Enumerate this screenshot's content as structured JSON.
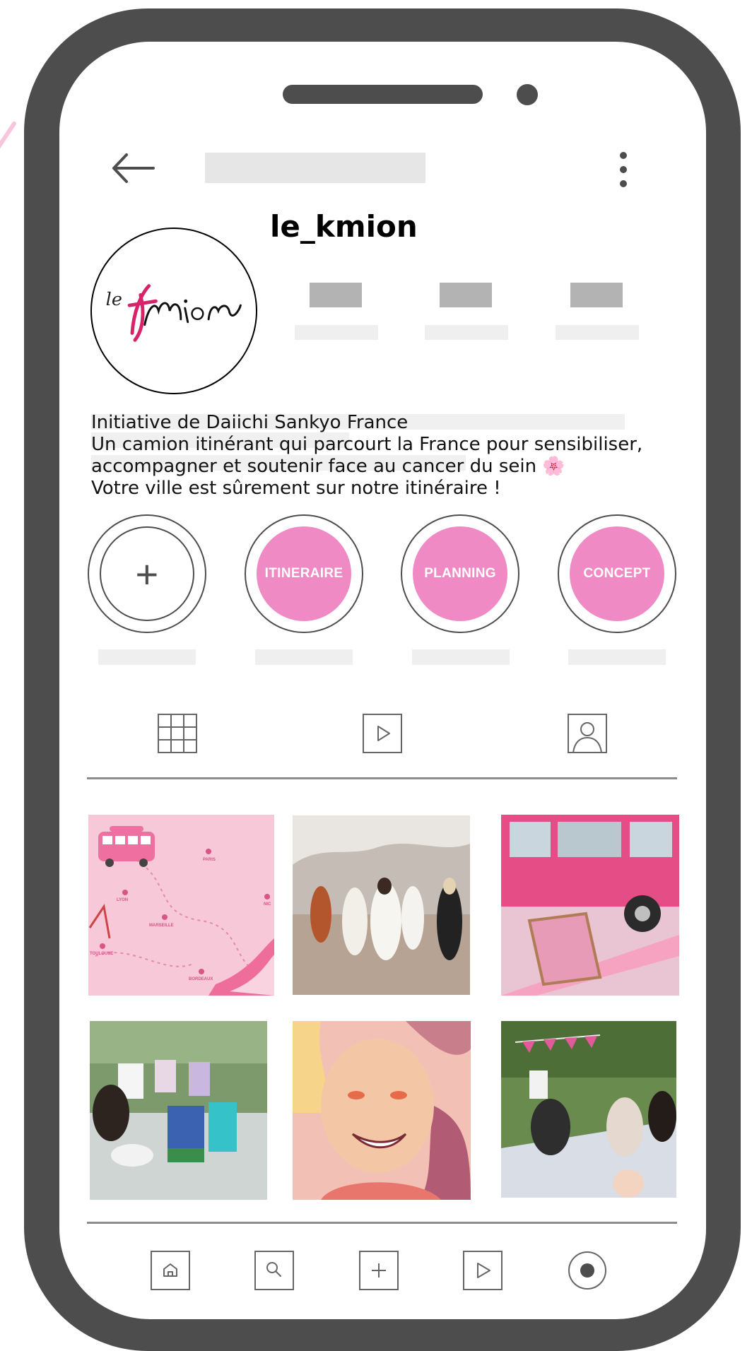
{
  "profile": {
    "username": "le_kmion",
    "avatar_logo": "le kmion",
    "bio": [
      "Initiative de Daiichi Sankyo France",
      "Un camion itinérant qui parcourt la France pour sensibiliser,",
      "accompagner et soutenir face au cancer du sein",
      "Votre ville est sûrement sur notre itinéraire !"
    ],
    "bio_emoji": "🌸"
  },
  "highlights": [
    {
      "label": "",
      "icon": "plus-icon"
    },
    {
      "label": "ITINERAIRE"
    },
    {
      "label": "PLANNING"
    },
    {
      "label": "CONCEPT"
    }
  ],
  "map_labels": {
    "paris": "PARIS",
    "lyon": "LYON",
    "marseille": "MARSEILLE",
    "toulouse": "TOULOUSE",
    "bordeaux": "BORDEAUX",
    "nice": "NIC"
  },
  "icons": {
    "back": "arrow-left-icon",
    "menu": "more-vertical-icon",
    "grid": "grid-icon",
    "reels": "play-icon",
    "tagged": "person-icon",
    "nav": [
      "home-icon",
      "search-icon",
      "add-icon",
      "play-icon",
      "profile-icon"
    ]
  },
  "colors": {
    "frame": "#4d4d4d",
    "accent_pink": "#ef8ac5",
    "placeholder": "#e6e6e6"
  }
}
